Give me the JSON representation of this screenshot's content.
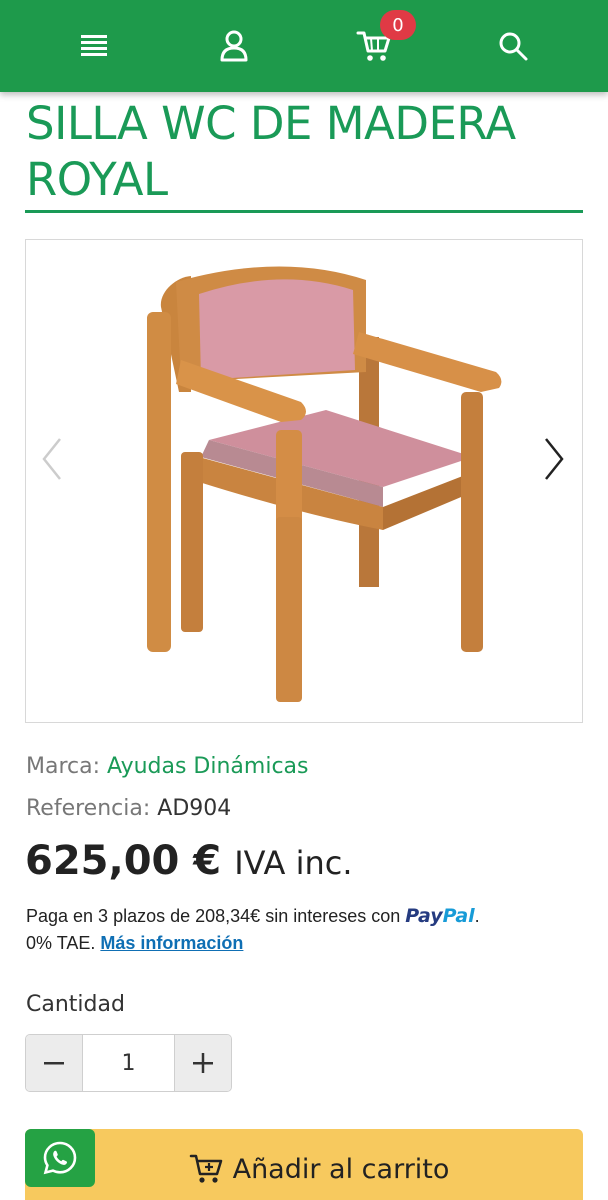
{
  "header": {
    "icons": [
      "menu-icon",
      "user-icon",
      "cart-icon",
      "search-icon"
    ],
    "cart_count": "0",
    "accent": "#1e9a4b",
    "badge_color": "#e03a45"
  },
  "product": {
    "title": "SILLA WC DE MADERA ROYAL",
    "brand_label": "Marca:",
    "brand_value": "Ayudas Dinámicas",
    "ref_label": "Referencia:",
    "ref_value": "AD904",
    "price": "625,00 €",
    "tax_note": "IVA inc.",
    "title_color": "#1a9a57"
  },
  "financing": {
    "text": "Paga en 3 plazos de 208,34€ sin intereses con",
    "logo_pay": "Pay",
    "logo_pal": "Pal",
    "after_logo": ".",
    "tae": "0% TAE.",
    "more_link": "Más información"
  },
  "quantity": {
    "label": "Cantidad",
    "value": "1",
    "decrement": "−",
    "increment": "+"
  },
  "cta": {
    "add_label": "Añadir al carrito",
    "button_color": "#f7c95e",
    "whatsapp_color": "#25a244"
  }
}
